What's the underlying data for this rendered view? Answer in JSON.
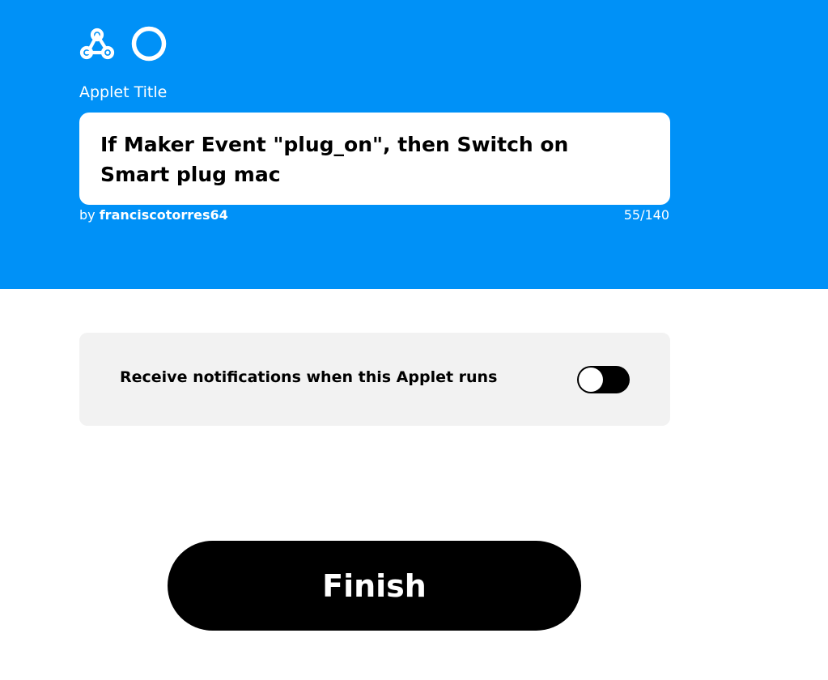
{
  "header": {
    "background_color": "#0091f7",
    "icons": [
      "webhook-icon",
      "ring-icon"
    ],
    "title_label": "Applet Title",
    "title_value": "If Maker Event \"plug_on\", then Switch on Smart plug mac",
    "byline_prefix": "by",
    "author": "franciscotorres64",
    "char_count": "55/140"
  },
  "notifications": {
    "label": "Receive notifications when this Applet runs",
    "toggle_on": false
  },
  "finish_label": "Finish"
}
